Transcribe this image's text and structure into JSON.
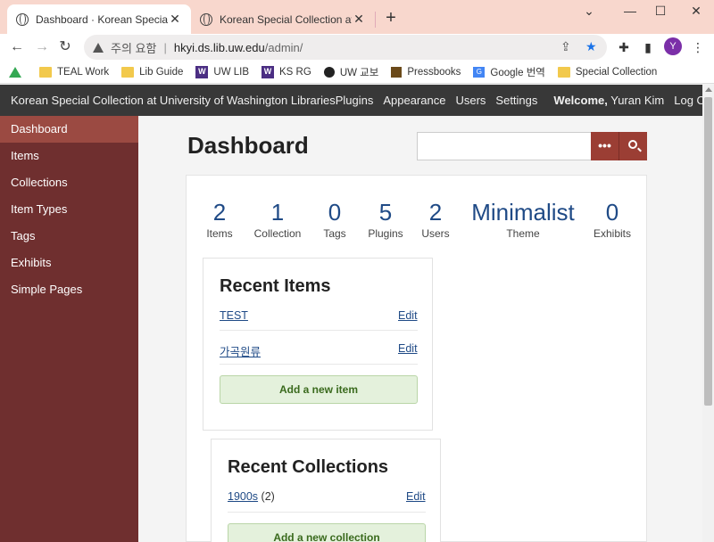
{
  "browser": {
    "tabs": [
      {
        "title": "Dashboard · Korean Special Coll",
        "active": true
      },
      {
        "title": "Korean Special Collection at Uni",
        "active": false
      }
    ],
    "new_tab": "+",
    "window": {
      "minimize": "⌄",
      "restore": "—",
      "maximize": "☐",
      "close": "✕"
    },
    "omnibox": {
      "warning": "주의 요함",
      "separator": "|",
      "host": "hkyi.ds.lib.uw.edu",
      "path": "/admin/"
    },
    "profile_initial": "Y",
    "bookmarks": [
      {
        "label": "",
        "icon": "drive-icon"
      },
      {
        "label": "TEAL Work",
        "icon": "folder-icon"
      },
      {
        "label": "Lib Guide",
        "icon": "folder-icon"
      },
      {
        "label": "UW LIB",
        "icon": "uw-icon"
      },
      {
        "label": "KS RG",
        "icon": "uw-icon"
      },
      {
        "label": "UW 교보",
        "icon": "globe-icon"
      },
      {
        "label": "Pressbooks",
        "icon": "pressbooks-icon"
      },
      {
        "label": "Google 번역",
        "icon": "translate-icon"
      },
      {
        "label": "Special Collection",
        "icon": "folder-icon"
      }
    ]
  },
  "site": {
    "title": "Korean Special Collection at University of Washington Libraries",
    "nav": [
      "Plugins",
      "Appearance",
      "Users",
      "Settings"
    ],
    "welcome_prefix": "Welcome,",
    "user": "Yuran Kim",
    "logout": "Log Out"
  },
  "sidebar": {
    "items": [
      "Dashboard",
      "Items",
      "Collections",
      "Item Types",
      "Tags",
      "Exhibits",
      "Simple Pages"
    ],
    "active_index": 0
  },
  "main": {
    "title": "Dashboard",
    "search": {
      "placeholder": "",
      "advanced_label": "•••"
    },
    "stats": [
      {
        "value": "2",
        "label": "Items"
      },
      {
        "value": "1",
        "label": "Collection"
      },
      {
        "value": "0",
        "label": "Tags"
      },
      {
        "value": "5",
        "label": "Plugins"
      },
      {
        "value": "2",
        "label": "Users"
      },
      {
        "value": "Minimalist",
        "label": "Theme"
      },
      {
        "value": "0",
        "label": "Exhibits"
      }
    ],
    "recent_items": {
      "heading": "Recent Items",
      "rows": [
        {
          "title": "TEST",
          "edit": "Edit"
        },
        {
          "title": "가곡원류",
          "edit": "Edit"
        }
      ],
      "add_label": "Add a new item"
    },
    "recent_collections": {
      "heading": "Recent Collections",
      "rows": [
        {
          "title": "1900s",
          "count": "(2)",
          "edit": "Edit"
        }
      ],
      "add_label": "Add a new collection"
    }
  },
  "colors": {
    "sidebar": "#6f2f2f",
    "sidebar_active": "#9b4a42",
    "header": "#383838",
    "accent": "#9b3e34",
    "stat_number": "#1f4a86",
    "add_button": "#e4f1dc",
    "tabbar": "#f8d7cd"
  }
}
